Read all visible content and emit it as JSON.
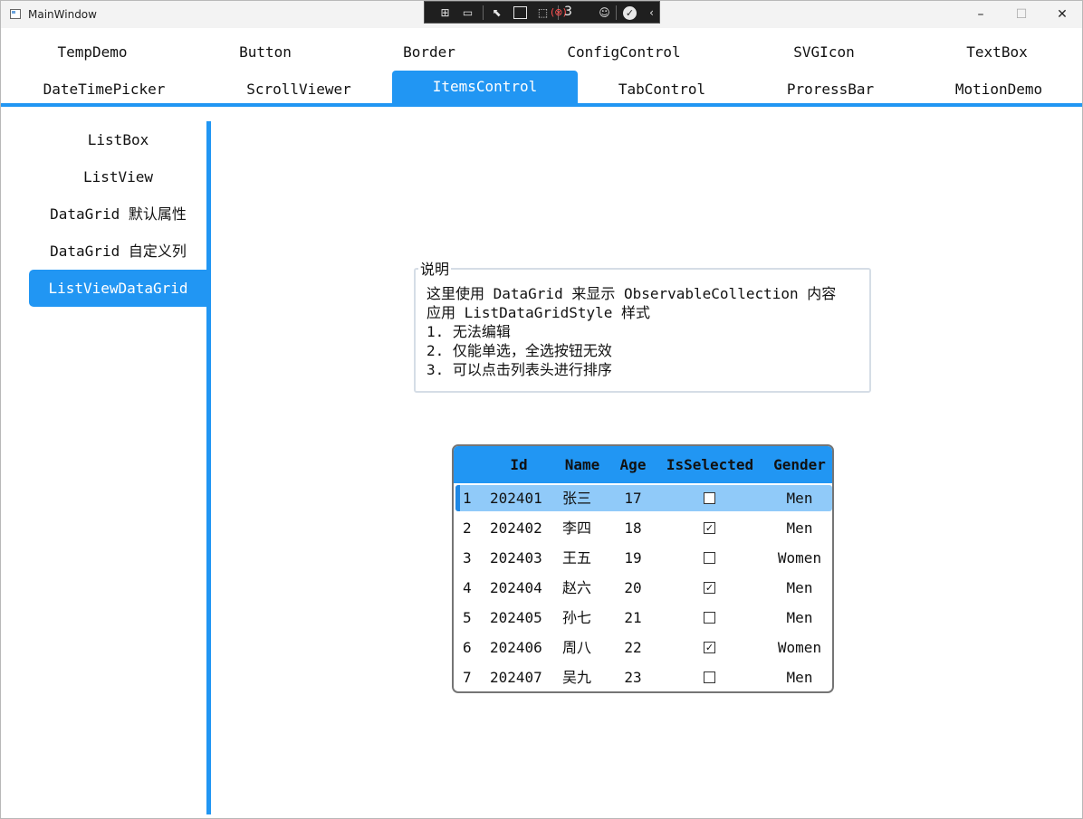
{
  "window": {
    "title": "MainWindow",
    "controls": {
      "minimize": "–",
      "maximize": "☐",
      "close": "✕"
    }
  },
  "debug_toolbar": {
    "error_count": "3"
  },
  "tabs": {
    "row1": [
      "TempDemo",
      "Button",
      "Border",
      "ConfigControl",
      "SVGIcon",
      "TextBox"
    ],
    "row2": [
      "DateTimePicker",
      "ScrollViewer",
      "ItemsControl",
      "TabControl",
      "ProressBar",
      "MotionDemo"
    ],
    "active": "ItemsControl"
  },
  "sidenav": {
    "items": [
      "ListBox",
      "ListView",
      "DataGrid 默认属性",
      "DataGrid 自定义列",
      "ListViewDataGrid"
    ],
    "active": "ListViewDataGrid"
  },
  "description": {
    "legend": "说明",
    "lines": [
      "这里使用 DataGrid 来显示 ObservableCollection 内容",
      "应用 ListDataGridStyle 样式",
      "1. 无法编辑",
      "2. 仅能单选，全选按钮无效",
      "3. 可以点击列表头进行排序"
    ]
  },
  "datagrid": {
    "columns": [
      "Id",
      "Name",
      "Age",
      "IsSelected",
      "Gender"
    ],
    "rows": [
      {
        "index": "1",
        "id": "202401",
        "name": "张三",
        "age": "17",
        "selected": false,
        "gender": "Men"
      },
      {
        "index": "2",
        "id": "202402",
        "name": "李四",
        "age": "18",
        "selected": true,
        "gender": "Men"
      },
      {
        "index": "3",
        "id": "202403",
        "name": "王五",
        "age": "19",
        "selected": false,
        "gender": "Women"
      },
      {
        "index": "4",
        "id": "202404",
        "name": "赵六",
        "age": "20",
        "selected": true,
        "gender": "Men"
      },
      {
        "index": "5",
        "id": "202405",
        "name": "孙七",
        "age": "21",
        "selected": false,
        "gender": "Men"
      },
      {
        "index": "6",
        "id": "202406",
        "name": "周八",
        "age": "22",
        "selected": true,
        "gender": "Women"
      },
      {
        "index": "7",
        "id": "202407",
        "name": "吴九",
        "age": "23",
        "selected": false,
        "gender": "Men"
      }
    ],
    "selected_row": "1"
  },
  "colors": {
    "accent": "#2196f3",
    "selected_row": "#90caf9",
    "grid_border": "#757575"
  }
}
